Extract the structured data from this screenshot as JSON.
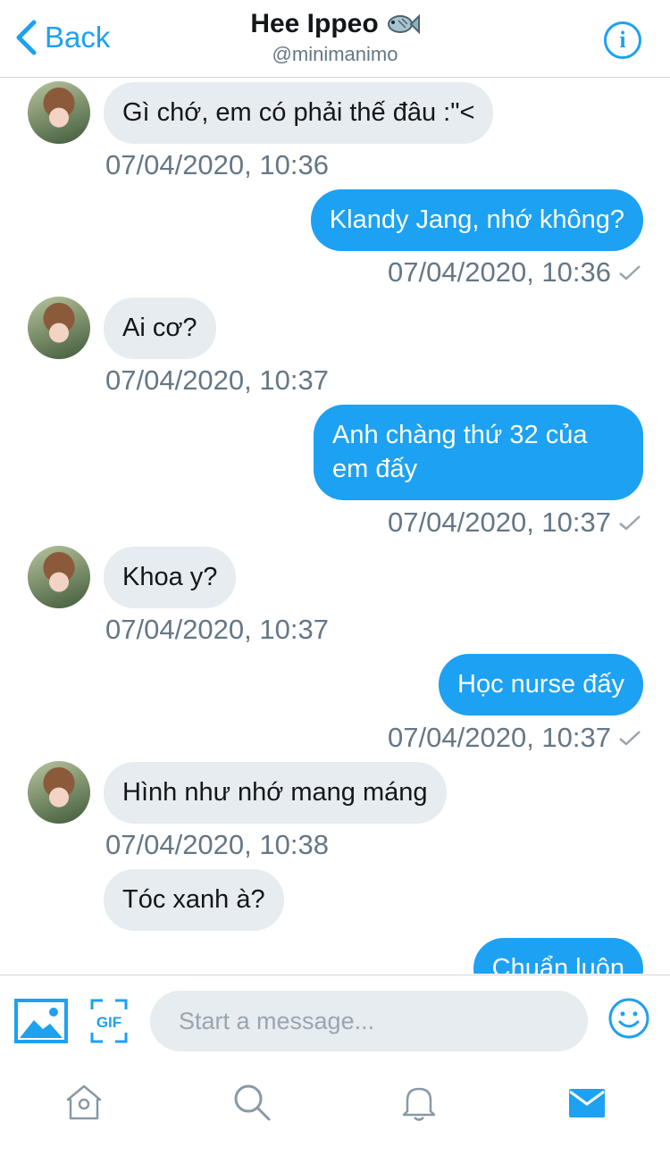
{
  "header": {
    "back_label": "Back",
    "name": "Hee Ippeo",
    "name_emoji": "fish-icon",
    "handle": "@minimanimo",
    "info_icon": "i"
  },
  "messages": [
    {
      "dir": "in",
      "text": "Gì chớ, em có phải thế đâu :\"<",
      "time": "07/04/2020, 10:36",
      "avatar": true
    },
    {
      "dir": "out",
      "text": "Klandy Jang, nhớ không?",
      "time": "07/04/2020, 10:36"
    },
    {
      "dir": "in",
      "text": "Ai cơ?",
      "time": "07/04/2020, 10:37",
      "avatar": true
    },
    {
      "dir": "out",
      "text_line1": "Anh chàng thứ 32 của",
      "text_line2": "em đấy",
      "time": "07/04/2020, 10:37"
    },
    {
      "dir": "in",
      "text": "Khoa y?",
      "time": "07/04/2020, 10:37",
      "avatar": true
    },
    {
      "dir": "out",
      "text": "Học nurse đấy",
      "time": "07/04/2020, 10:37"
    },
    {
      "dir": "in",
      "text": "Hình như nhớ mang máng",
      "time": "07/04/2020, 10:38",
      "avatar": true
    },
    {
      "dir": "in",
      "text": "Tóc xanh à?"
    },
    {
      "dir": "out",
      "text": "Chuẩn luôn"
    }
  ],
  "composer": {
    "placeholder": "Start a message...",
    "gif_label": "GIF"
  },
  "tabs": [
    "home-icon",
    "search-icon",
    "notifications-icon",
    "messages-icon"
  ],
  "colors": {
    "accent": "#1da1f2",
    "bubble_in": "#e6ecf0",
    "muted": "#657786"
  }
}
